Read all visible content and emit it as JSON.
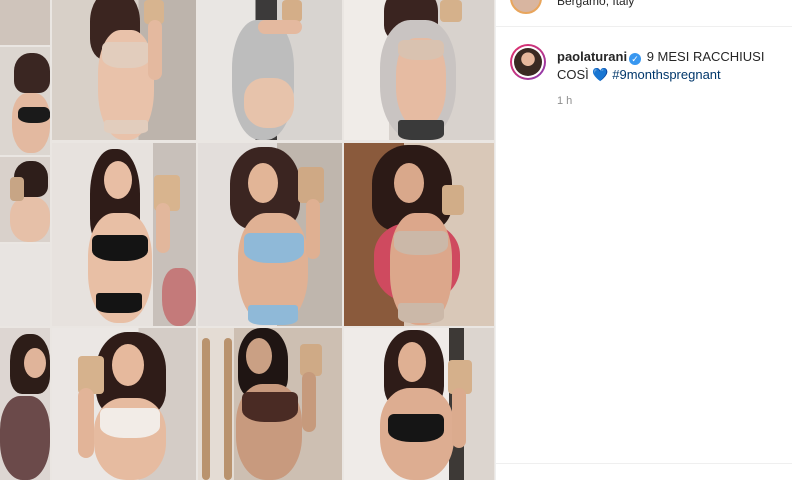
{
  "post": {
    "location": "Bergamo, Italy",
    "caption": {
      "username": "paolaturani",
      "text_part1": "9 MESI RACCHIUSI COSÌ",
      "heart": "💙",
      "hashtag": "#9monthspregnant"
    },
    "time": "1 h"
  },
  "icons": {
    "verified": "verified-badge-icon",
    "heart": "blue-heart-emoji"
  },
  "colors": {
    "verified": "#3897f0",
    "hashtag": "#00376b",
    "muted": "#8e8e8e"
  }
}
